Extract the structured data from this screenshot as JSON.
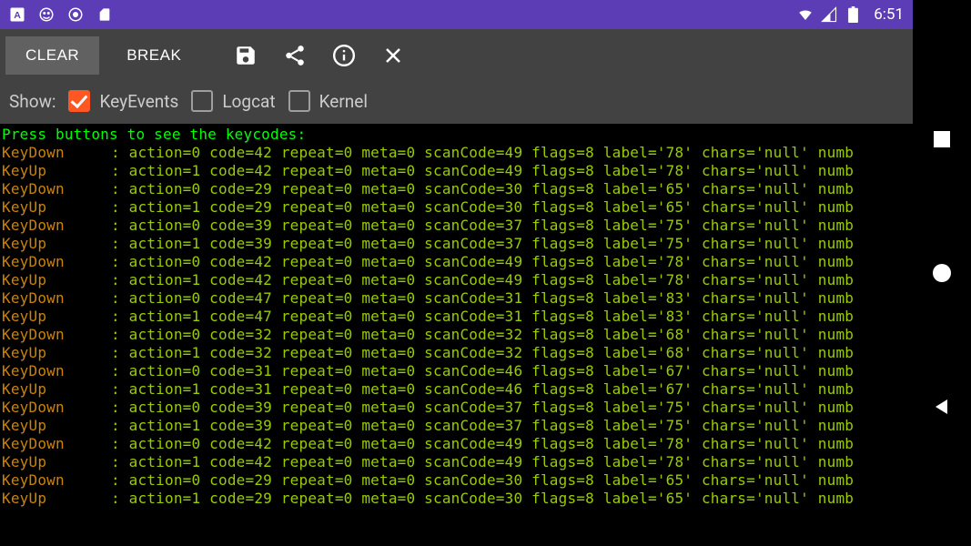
{
  "statusbar": {
    "clock": "6:51"
  },
  "toolbar": {
    "clear_label": "CLEAR",
    "break_label": "BREAK"
  },
  "filters": {
    "show_label": "Show:",
    "keyevents": {
      "label": "KeyEvents",
      "checked": true
    },
    "logcat": {
      "label": "Logcat",
      "checked": false
    },
    "kernel": {
      "label": "Kernel",
      "checked": false
    }
  },
  "terminal": {
    "header": "Press buttons to see the keycodes:",
    "events": [
      {
        "tag": "KeyDown",
        "action": 0,
        "code": 42,
        "repeat": 0,
        "meta": 0,
        "scanCode": 49,
        "flags": 8,
        "label": "78",
        "chars": "null"
      },
      {
        "tag": "KeyUp",
        "action": 1,
        "code": 42,
        "repeat": 0,
        "meta": 0,
        "scanCode": 49,
        "flags": 8,
        "label": "78",
        "chars": "null"
      },
      {
        "tag": "KeyDown",
        "action": 0,
        "code": 29,
        "repeat": 0,
        "meta": 0,
        "scanCode": 30,
        "flags": 8,
        "label": "65",
        "chars": "null"
      },
      {
        "tag": "KeyUp",
        "action": 1,
        "code": 29,
        "repeat": 0,
        "meta": 0,
        "scanCode": 30,
        "flags": 8,
        "label": "65",
        "chars": "null"
      },
      {
        "tag": "KeyDown",
        "action": 0,
        "code": 39,
        "repeat": 0,
        "meta": 0,
        "scanCode": 37,
        "flags": 8,
        "label": "75",
        "chars": "null"
      },
      {
        "tag": "KeyUp",
        "action": 1,
        "code": 39,
        "repeat": 0,
        "meta": 0,
        "scanCode": 37,
        "flags": 8,
        "label": "75",
        "chars": "null"
      },
      {
        "tag": "KeyDown",
        "action": 0,
        "code": 42,
        "repeat": 0,
        "meta": 0,
        "scanCode": 49,
        "flags": 8,
        "label": "78",
        "chars": "null"
      },
      {
        "tag": "KeyUp",
        "action": 1,
        "code": 42,
        "repeat": 0,
        "meta": 0,
        "scanCode": 49,
        "flags": 8,
        "label": "78",
        "chars": "null"
      },
      {
        "tag": "KeyDown",
        "action": 0,
        "code": 47,
        "repeat": 0,
        "meta": 0,
        "scanCode": 31,
        "flags": 8,
        "label": "83",
        "chars": "null"
      },
      {
        "tag": "KeyUp",
        "action": 1,
        "code": 47,
        "repeat": 0,
        "meta": 0,
        "scanCode": 31,
        "flags": 8,
        "label": "83",
        "chars": "null"
      },
      {
        "tag": "KeyDown",
        "action": 0,
        "code": 32,
        "repeat": 0,
        "meta": 0,
        "scanCode": 32,
        "flags": 8,
        "label": "68",
        "chars": "null"
      },
      {
        "tag": "KeyUp",
        "action": 1,
        "code": 32,
        "repeat": 0,
        "meta": 0,
        "scanCode": 32,
        "flags": 8,
        "label": "68",
        "chars": "null"
      },
      {
        "tag": "KeyDown",
        "action": 0,
        "code": 31,
        "repeat": 0,
        "meta": 0,
        "scanCode": 46,
        "flags": 8,
        "label": "67",
        "chars": "null"
      },
      {
        "tag": "KeyUp",
        "action": 1,
        "code": 31,
        "repeat": 0,
        "meta": 0,
        "scanCode": 46,
        "flags": 8,
        "label": "67",
        "chars": "null"
      },
      {
        "tag": "KeyDown",
        "action": 0,
        "code": 39,
        "repeat": 0,
        "meta": 0,
        "scanCode": 37,
        "flags": 8,
        "label": "75",
        "chars": "null"
      },
      {
        "tag": "KeyUp",
        "action": 1,
        "code": 39,
        "repeat": 0,
        "meta": 0,
        "scanCode": 37,
        "flags": 8,
        "label": "75",
        "chars": "null"
      },
      {
        "tag": "KeyDown",
        "action": 0,
        "code": 42,
        "repeat": 0,
        "meta": 0,
        "scanCode": 49,
        "flags": 8,
        "label": "78",
        "chars": "null"
      },
      {
        "tag": "KeyUp",
        "action": 1,
        "code": 42,
        "repeat": 0,
        "meta": 0,
        "scanCode": 49,
        "flags": 8,
        "label": "78",
        "chars": "null"
      },
      {
        "tag": "KeyDown",
        "action": 0,
        "code": 29,
        "repeat": 0,
        "meta": 0,
        "scanCode": 30,
        "flags": 8,
        "label": "65",
        "chars": "null"
      },
      {
        "tag": "KeyUp",
        "action": 1,
        "code": 29,
        "repeat": 0,
        "meta": 0,
        "scanCode": 30,
        "flags": 8,
        "label": "65",
        "chars": "null"
      }
    ]
  }
}
